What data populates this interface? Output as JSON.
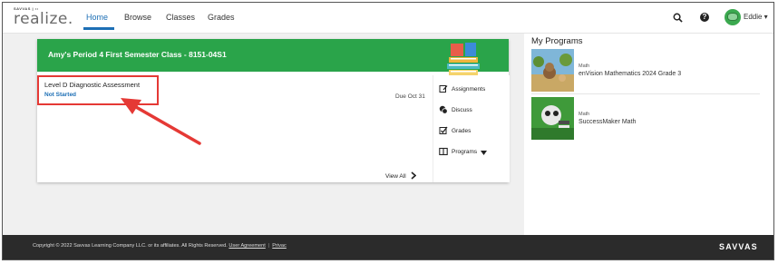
{
  "header": {
    "logo_top": "SAVVAS | ••",
    "logo_word": "realize.",
    "nav": [
      {
        "label": "Home"
      },
      {
        "label": "Browse"
      },
      {
        "label": "Classes"
      },
      {
        "label": "Grades"
      }
    ],
    "help_glyph": "?",
    "user_name": "Eddie ▾",
    "icons": [
      "search-icon",
      "help-icon",
      "avatar",
      "chevron-down-icon"
    ]
  },
  "class_card": {
    "title": "Amy's Period 4 First Semester Class - 8151-04S1",
    "assignment": {
      "title": "Level D Diagnostic Assessment",
      "status": "Not Started",
      "due": "Due Oct 31"
    },
    "menu": [
      {
        "label": "Assignments",
        "icon": "assignment-icon"
      },
      {
        "label": "Discuss",
        "icon": "discuss-icon"
      },
      {
        "label": "Grades",
        "icon": "grades-icon"
      },
      {
        "label": "Programs",
        "icon": "book-icon"
      }
    ],
    "view_all": "View All",
    "header_color": "#2aa44a"
  },
  "my_programs": {
    "title": "My Programs",
    "items": [
      {
        "subject": "Math",
        "name": "enVision Mathematics 2024 Grade 3"
      },
      {
        "subject": "Math",
        "name": "SuccessMaker Math"
      }
    ]
  },
  "footer": {
    "copyright": "Copyright © 2022 Savvas Learning Company LLC. or its affiliates. All Rights Reserved.",
    "user_agreement": "User Agreement",
    "privacy": "Privac",
    "brand": "SAVVAS"
  },
  "colors": {
    "accent": "#1d6fb5",
    "annotation": "#e53935"
  }
}
